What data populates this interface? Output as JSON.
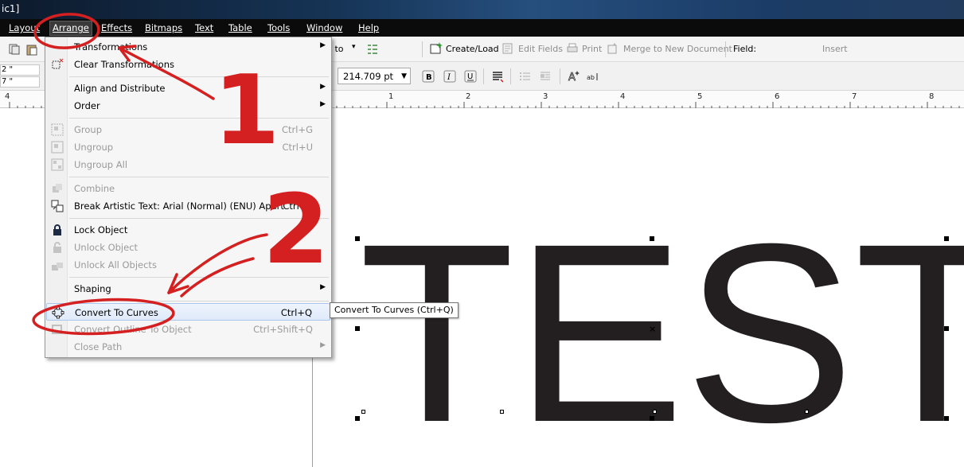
{
  "window": {
    "title": "ic1]"
  },
  "menubar": {
    "items": [
      "Layout",
      "Arrange",
      "Effects",
      "Bitmaps",
      "Text",
      "Table",
      "Tools",
      "Window",
      "Help"
    ],
    "active": "Arrange"
  },
  "toolbar": {
    "snap_label": "p to",
    "create_load": "Create/Load",
    "edit_fields": "Edit Fields",
    "print": "Print",
    "merge": "Merge to New Document",
    "field_label": "Field:",
    "insert": "Insert",
    "font_size": "214.709 pt",
    "coord_x": "2 \"",
    "coord_y": "7 \""
  },
  "ruler": {
    "labels": [
      "4",
      "1",
      "2",
      "3",
      "4",
      "5",
      "6",
      "7",
      "8"
    ]
  },
  "canvas": {
    "text": "TEST",
    "text_color": "#231f20"
  },
  "arrange_menu": {
    "transformations": "Transformations",
    "clear_transformations": "Clear Transformations",
    "align": "Align and Distribute",
    "order": "Order",
    "group": {
      "label": "Group",
      "shortcut": "Ctrl+G"
    },
    "ungroup": {
      "label": "Ungroup",
      "shortcut": "Ctrl+U"
    },
    "ungroup_all": "Ungroup All",
    "combine": "Combine",
    "break_apart": {
      "label": "Break Artistic Text: Arial (Normal) (ENU) Apart",
      "shortcut": "Ctrl+K"
    },
    "lock": "Lock Object",
    "unlock": "Unlock Object",
    "unlock_all": "Unlock All Objects",
    "shaping": "Shaping",
    "convert_curves": {
      "label": "Convert To Curves",
      "shortcut": "Ctrl+Q"
    },
    "convert_outline": {
      "label": "Convert Outline To Object",
      "shortcut": "Ctrl+Shift+Q"
    },
    "close_path": "Close Path"
  },
  "tooltip": "Convert To Curves (Ctrl+Q)",
  "annotations": {
    "step1": "1",
    "step2": "2",
    "color": "#d42020"
  }
}
